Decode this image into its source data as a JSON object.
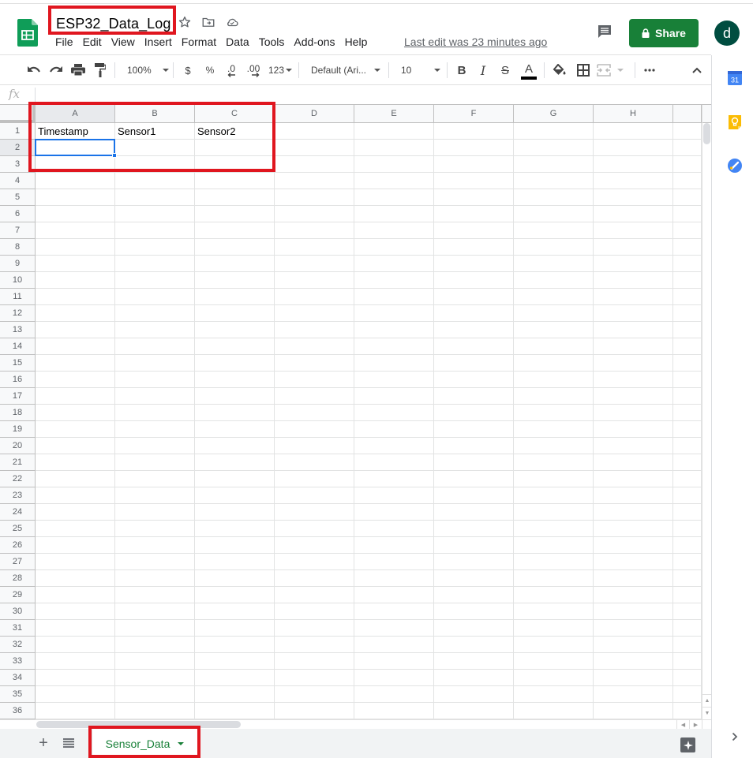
{
  "document": {
    "title": "ESP32_Data_Log",
    "last_edit": "Last edit was 23 minutes ago",
    "app_icon": "google-sheets-icon",
    "title_icons": [
      "star-icon",
      "move-to-folder-icon",
      "cloud-saved-icon"
    ]
  },
  "menu": {
    "items": [
      "File",
      "Edit",
      "View",
      "Insert",
      "Format",
      "Data",
      "Tools",
      "Add-ons",
      "Help"
    ]
  },
  "header_actions": {
    "comment_icon": "comment-history-icon",
    "share_label": "Share",
    "share_icon": "lock-icon",
    "avatar_letter": "d"
  },
  "toolbar": {
    "zoom": "100%",
    "currency": "$",
    "percent": "%",
    "decrease_decimal": ".0",
    "increase_decimal": ".00",
    "more_formats": "123",
    "font_family": "Default (Ari...",
    "font_size": "10",
    "bold": "B",
    "italic": "I",
    "strikethrough": "S",
    "text_color": "A",
    "text_color_value": "#000000",
    "icons": [
      "undo-icon",
      "redo-icon",
      "print-icon",
      "paint-format-icon",
      "fill-color-icon",
      "borders-icon",
      "merge-cells-icon",
      "more-icon",
      "collapse-icon"
    ]
  },
  "formula_bar": {
    "fx_label": "fx",
    "value": ""
  },
  "sheet": {
    "columns": [
      "A",
      "B",
      "C",
      "D",
      "E",
      "F",
      "G",
      "H"
    ],
    "rows": [
      "1",
      "2",
      "3",
      "4",
      "5",
      "6",
      "7",
      "8",
      "9",
      "10",
      "11",
      "12",
      "13",
      "14",
      "15",
      "16",
      "17",
      "18",
      "19",
      "20",
      "21",
      "22",
      "23",
      "24",
      "25",
      "26",
      "27",
      "28",
      "29",
      "30",
      "31",
      "32",
      "33",
      "34",
      "35",
      "36"
    ],
    "cells": {
      "A1": "Timestamp",
      "B1": "Sensor1",
      "C1": "Sensor2"
    },
    "active_cell": "A2",
    "selected_column": "A",
    "selected_row": "2"
  },
  "sheet_tabs": {
    "tabs": [
      {
        "label": "Sensor_Data",
        "active": true
      }
    ],
    "add_label": "+",
    "accent": "#188038"
  },
  "side_panel": {
    "apps": [
      "google-calendar-icon",
      "google-keep-icon",
      "google-tasks-icon"
    ],
    "calendar_day": "31"
  },
  "colors": {
    "share_button": "#188038",
    "selection": "#1a73e8",
    "annotation": "#e0161f",
    "avatar": "#004d40"
  }
}
